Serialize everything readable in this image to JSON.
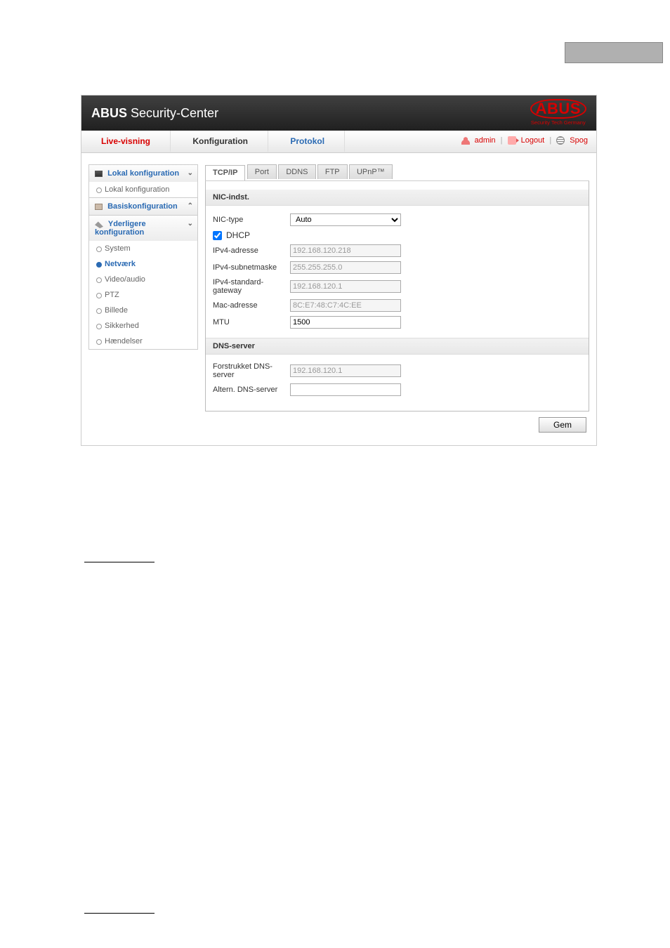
{
  "header": {
    "title_bold": "ABUS",
    "title_thin": " Security-Center",
    "logo_text": "ABUS",
    "logo_tagline": "Security Tech Germany",
    "help_icon": "?"
  },
  "topnav": {
    "tabs": [
      {
        "label": "Live-visning"
      },
      {
        "label": "Konfiguration"
      },
      {
        "label": "Protokol"
      }
    ],
    "admin": "admin",
    "logout": "Logout",
    "lang": "Spog"
  },
  "sidebar": {
    "groups": [
      {
        "label": "Lokal konfiguration",
        "items": [
          {
            "label": "Lokal konfiguration",
            "sel": false
          }
        ]
      },
      {
        "label": "Basiskonfiguration",
        "collapsed": true,
        "items": []
      },
      {
        "label": "Yderligere konfiguration",
        "items": [
          {
            "label": "System",
            "sel": false
          },
          {
            "label": "Netværk",
            "sel": true
          },
          {
            "label": "Video/audio",
            "sel": false
          },
          {
            "label": "PTZ",
            "sel": false
          },
          {
            "label": "Billede",
            "sel": false
          },
          {
            "label": "Sikkerhed",
            "sel": false
          },
          {
            "label": "Hændelser",
            "sel": false
          }
        ]
      }
    ]
  },
  "subtabs": [
    {
      "label": "TCP/IP",
      "active": true
    },
    {
      "label": "Port"
    },
    {
      "label": "DDNS"
    },
    {
      "label": "FTP"
    },
    {
      "label": "UPnP™"
    }
  ],
  "form": {
    "section_nic": "NIC-indst.",
    "nic_type_label": "NIC-type",
    "nic_type_value": "Auto",
    "dhcp_label": "DHCP",
    "dhcp_checked": true,
    "ipv4_addr_label": "IPv4-adresse",
    "ipv4_addr_value": "192.168.120.218",
    "ipv4_mask_label": "IPv4-subnetmaske",
    "ipv4_mask_value": "255.255.255.0",
    "ipv4_gw_label": "IPv4-standard-gateway",
    "ipv4_gw_value": "192.168.120.1",
    "mac_label": "Mac-adresse",
    "mac_value": "8C:E7:48:C7:4C:EE",
    "mtu_label": "MTU",
    "mtu_value": "1500",
    "section_dns": "DNS-server",
    "dns_pref_label": "Forstrukket DNS-server",
    "dns_pref_value": "192.168.120.1",
    "dns_alt_label": "Altern. DNS-server",
    "dns_alt_value": ""
  },
  "buttons": {
    "save": "Gem"
  }
}
